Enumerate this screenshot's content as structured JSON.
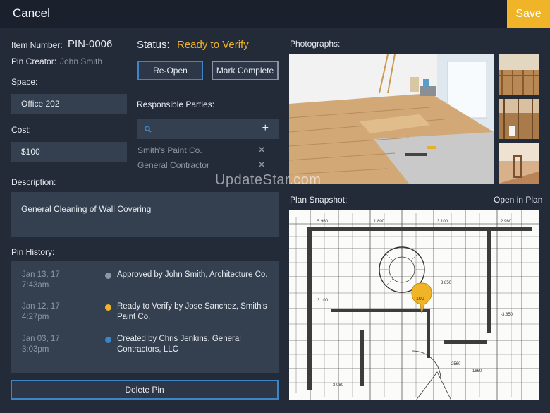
{
  "topbar": {
    "cancel_label": "Cancel",
    "save_label": "Save"
  },
  "item": {
    "number_label": "Item Number:",
    "number_value": "PIN-0006",
    "creator_label": "Pin Creator:",
    "creator_value": "John Smith"
  },
  "status": {
    "label": "Status:",
    "value": "Ready to Verify",
    "color": "#f0b429"
  },
  "actions": {
    "reopen_label": "Re-Open",
    "complete_label": "Mark Complete"
  },
  "space": {
    "label": "Space:",
    "value": "Office 202"
  },
  "cost": {
    "label": "Cost:",
    "value": "$100"
  },
  "responsible": {
    "label": "Responsible Parties:",
    "search_icon": "search-icon",
    "add_icon": "plus-icon",
    "parties": [
      "Smith's Paint Co.",
      "General Contractor"
    ]
  },
  "description": {
    "label": "Description:",
    "value": "General Cleaning of Wall Covering"
  },
  "history": {
    "label": "Pin History:",
    "entries": [
      {
        "date": "Jan 13, 17",
        "time": "7:43am",
        "text": "Approved by John Smith, Architecture Co.",
        "dot_color": "#8d96a6"
      },
      {
        "date": "Jan 12, 17",
        "time": "4:27pm",
        "text": "Ready to Verify by Jose Sanchez, Smith's Paint Co.",
        "dot_color": "#f0b429"
      },
      {
        "date": "Jan 03, 17",
        "time": "3:03pm",
        "text": "Created by Chris Jenkins, General Contractors, LLC",
        "dot_color": "#3a86c8"
      }
    ]
  },
  "delete_label": "Delete Pin",
  "photos": {
    "label": "Photographs:"
  },
  "plan": {
    "label": "Plan Snapshot:",
    "open_label": "Open in Plan",
    "pin_number": "100"
  },
  "watermark": "UpdateStar.com"
}
